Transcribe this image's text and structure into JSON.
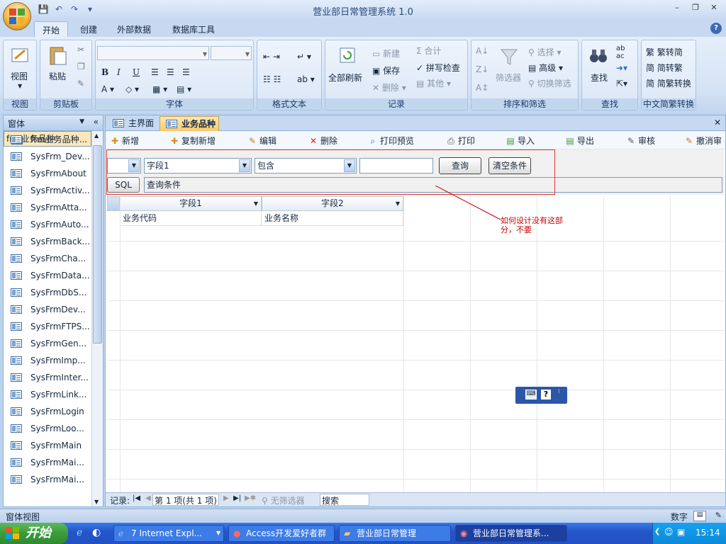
{
  "window": {
    "title": "营业部日常管理系统 1.0",
    "controls": [
      "–",
      "❐",
      "✕"
    ],
    "help": "?"
  },
  "ribbon_tabs": [
    "开始",
    "创建",
    "外部数据",
    "数据库工具"
  ],
  "ribbon": {
    "view": {
      "label": "视图",
      "group": "视图"
    },
    "clipboard": {
      "paste": "粘贴",
      "group": "剪贴板"
    },
    "font": {
      "group": "字体",
      "bold": "B",
      "italic": "I",
      "underline": "U"
    },
    "rich_text": {
      "group": "格式文本"
    },
    "records": {
      "group": "记录",
      "refresh": "全部刷新",
      "new": "新建",
      "save": "保存",
      "delete": "删除",
      "totals": "合计",
      "spelling": "拼写检查",
      "more": "其他"
    },
    "sort_filter": {
      "group": "排序和筛选",
      "filter": "筛选器",
      "selection": "选择",
      "advanced": "高级",
      "toggle": "切换筛选"
    },
    "find": {
      "group": "查找",
      "find": "查找"
    },
    "chinese": {
      "group": "中文简繁转换",
      "t2s": "繁转简",
      "s2t": "简转繁",
      "convert": "简繁转换"
    }
  },
  "nav": {
    "title": "窗体",
    "items": [
      "frm业务品种",
      "frm业务品种...",
      "SysFrm_Dev...",
      "SysFrmAbout",
      "SysFrmActiv...",
      "SysFrmAtta...",
      "SysFrmAuto...",
      "SysFrmBack...",
      "SysFrmCha...",
      "SysFrmData...",
      "SysFrmDbS...",
      "SysFrmDev...",
      "SysFrmFTPS...",
      "SysFrmGen...",
      "SysFrmImp...",
      "SysFrmInter...",
      "SysFrmLink...",
      "SysFrmLogin",
      "SysFrmLoo...",
      "SysFrmMain",
      "SysFrmMai...",
      "SysFrmMai..."
    ]
  },
  "doc_tabs": [
    "主界面",
    "业务品种"
  ],
  "toolbar": [
    "新增",
    "复制新增",
    "编辑",
    "删除",
    "打印预览",
    "打印",
    "导入",
    "导出",
    "审核",
    "撤消审"
  ],
  "filter": {
    "field": "字段1",
    "op": "包含",
    "query": "查询",
    "clear": "清空条件",
    "sql": "SQL",
    "condition": "查询条件"
  },
  "grid": {
    "columns": [
      "字段1",
      "字段2"
    ],
    "rows": [
      [
        "业务代码",
        "业务名称"
      ]
    ]
  },
  "record_nav": {
    "label": "记录:",
    "position": "第 1 项(共 1 项)",
    "no_filter": "无筛选器",
    "search": "搜索"
  },
  "annotation": "如何设计没有这部分，不要",
  "statusbar": {
    "left": "窗体视图",
    "right": "数字"
  },
  "taskbar": {
    "start": "开始",
    "tasks": [
      "7 Internet Expl...",
      "Access开发爱好者群",
      "营业部日常管理",
      "营业部日常管理系..."
    ],
    "time": "15:14"
  }
}
